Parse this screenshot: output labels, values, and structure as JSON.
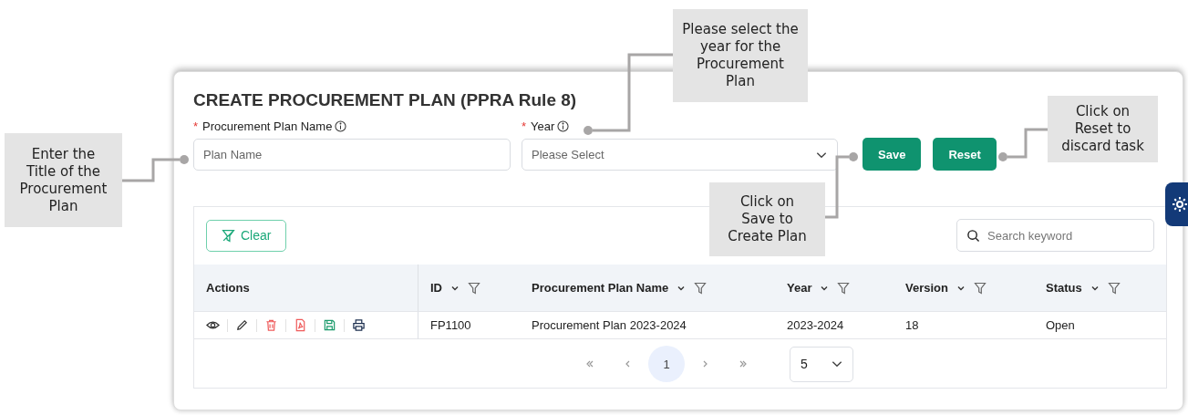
{
  "form": {
    "title": "CREATE PROCUREMENT PLAN (PPRA Rule 8)",
    "name_field": {
      "required_mark": "*",
      "label": "Procurement Plan Name",
      "placeholder": "Plan Name"
    },
    "year_field": {
      "required_mark": "*",
      "label": "Year",
      "placeholder": "Please Select"
    },
    "buttons": [
      "Save",
      "Reset"
    ]
  },
  "table_panel": {
    "clear_button": "Clear",
    "search": {
      "placeholder": "Search keyword"
    },
    "columns": [
      {
        "label": "Actions",
        "kind": "plain"
      },
      {
        "label": "ID",
        "kind": "sortable"
      },
      {
        "label": "Procurement Plan Name",
        "kind": "sortable"
      },
      {
        "label": "Year",
        "kind": "sortable"
      },
      {
        "label": "Version",
        "kind": "sortable"
      },
      {
        "label": "Status",
        "kind": "sortable"
      }
    ],
    "rows": [
      [
        "",
        "FP1100",
        "Procurement Plan 2023-2024",
        "2023-2024",
        "18",
        "Open"
      ]
    ],
    "pagination": {
      "pages": [
        {
          "label": "1",
          "selected": true
        }
      ],
      "page_size": "5"
    }
  },
  "callouts": [
    {
      "text": "Enter the Title of the Procurement Plan"
    },
    {
      "text": "Please select the year for the Procurement Plan"
    },
    {
      "text": "Click on Save to Create Plan"
    },
    {
      "text": "Click on Reset to discard task"
    }
  ]
}
